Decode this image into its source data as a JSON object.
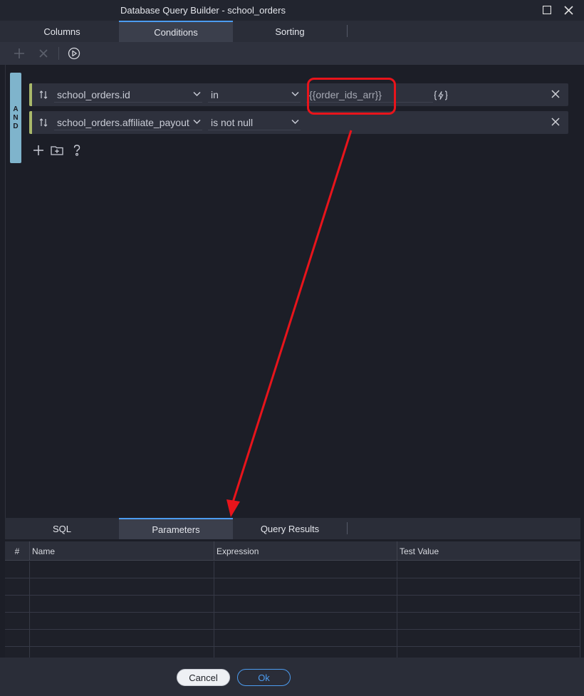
{
  "window": {
    "title": "Database Query Builder - school_orders"
  },
  "top_tabs": [
    {
      "label": "Columns",
      "active": false
    },
    {
      "label": "Conditions",
      "active": true
    },
    {
      "label": "Sorting",
      "active": false
    }
  ],
  "toolbar": {
    "add_icon": "plus-icon",
    "remove_icon": "close-icon",
    "run_icon": "play-circle-icon"
  },
  "conditions": {
    "group_operator": [
      "A",
      "N",
      "D"
    ],
    "rows": [
      {
        "field": "school_orders.id",
        "operator": "in",
        "value": "{{order_ids_arr}}"
      },
      {
        "field": "school_orders.affiliate_payout",
        "operator": "is not null",
        "value": ""
      }
    ]
  },
  "bottom_tabs": [
    {
      "label": "SQL",
      "active": false
    },
    {
      "label": "Parameters",
      "active": true
    },
    {
      "label": "Query Results",
      "active": false
    }
  ],
  "parameters_grid": {
    "columns": [
      "#",
      "Name",
      "Expression",
      "Test Value"
    ],
    "rows": [
      {
        "num": "",
        "name": "",
        "expression": "",
        "test_value": ""
      },
      {
        "num": "",
        "name": "",
        "expression": "",
        "test_value": ""
      },
      {
        "num": "",
        "name": "",
        "expression": "",
        "test_value": ""
      },
      {
        "num": "",
        "name": "",
        "expression": "",
        "test_value": ""
      },
      {
        "num": "",
        "name": "",
        "expression": "",
        "test_value": ""
      },
      {
        "num": "",
        "name": "",
        "expression": "",
        "test_value": ""
      }
    ]
  },
  "footer": {
    "cancel_label": "Cancel",
    "ok_label": "Ok"
  },
  "colors": {
    "accent": "#4c9cf0",
    "annotation": "#e8141b",
    "and_bar": "#7fb4cc",
    "row_marker": "#a9b86a"
  }
}
